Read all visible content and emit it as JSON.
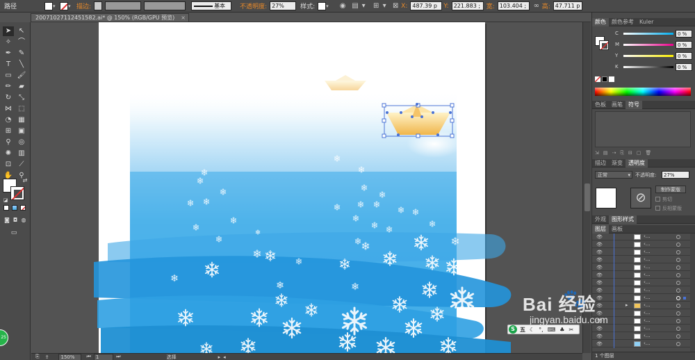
{
  "control_bar": {
    "object_type": "路径",
    "stroke_label": "描边:",
    "brush_label": "基本",
    "opacity_label": "不透明度:",
    "opacity_value": "27%",
    "style_label": "样式:",
    "x_label": "X:",
    "x_value": "487.39 p",
    "y_label": "Y:",
    "y_value": "221.883 ;",
    "w_label": "宽:",
    "w_value": "103.404 ;",
    "h_label": "高:",
    "h_value": "47.711 p"
  },
  "document": {
    "tab_title": "20071027112451582.ai* @ 150% (RGB/GPU 预览)"
  },
  "status_bar": {
    "zoom": "150%",
    "page": "1",
    "tool_name": "选择"
  },
  "color_panel": {
    "tabs": [
      "颜色",
      "颜色参考",
      "Kuler"
    ],
    "channels": [
      {
        "letter": "C",
        "value": "0 %"
      },
      {
        "letter": "M",
        "value": "0 %"
      },
      {
        "letter": "Y",
        "value": "0 %"
      },
      {
        "letter": "K",
        "value": "0 %"
      }
    ]
  },
  "swatch_panel": {
    "tabs": [
      "色板",
      "画笔",
      "符号"
    ]
  },
  "transparency_panel": {
    "tabs": [
      "描边",
      "渐变",
      "透明度"
    ],
    "blend_mode": "正常",
    "opacity_label": "不透明度:",
    "opacity_value": "27%",
    "make_mask_label": "制作蒙版",
    "clip_label": "剪切",
    "invert_label": "反相蒙版"
  },
  "appearance_panel": {
    "tabs": [
      "外观",
      "图形样式"
    ]
  },
  "layers_panel": {
    "tabs": [
      "图层",
      "画板"
    ],
    "footer": "1 个图层"
  },
  "watermark": {
    "brand": "Bai 经验",
    "url": "jingyan.baidu.com"
  },
  "ime_bar": {
    "label": "五"
  },
  "colors": {
    "sky_blue": "#4fb3ea",
    "deep_blue": "#1f8fd3",
    "wave_blue": "#2e9fe0",
    "ui_dark": "#4b4b4b",
    "selection": "#4a73d6",
    "accent_orange": "#e88a2a"
  }
}
